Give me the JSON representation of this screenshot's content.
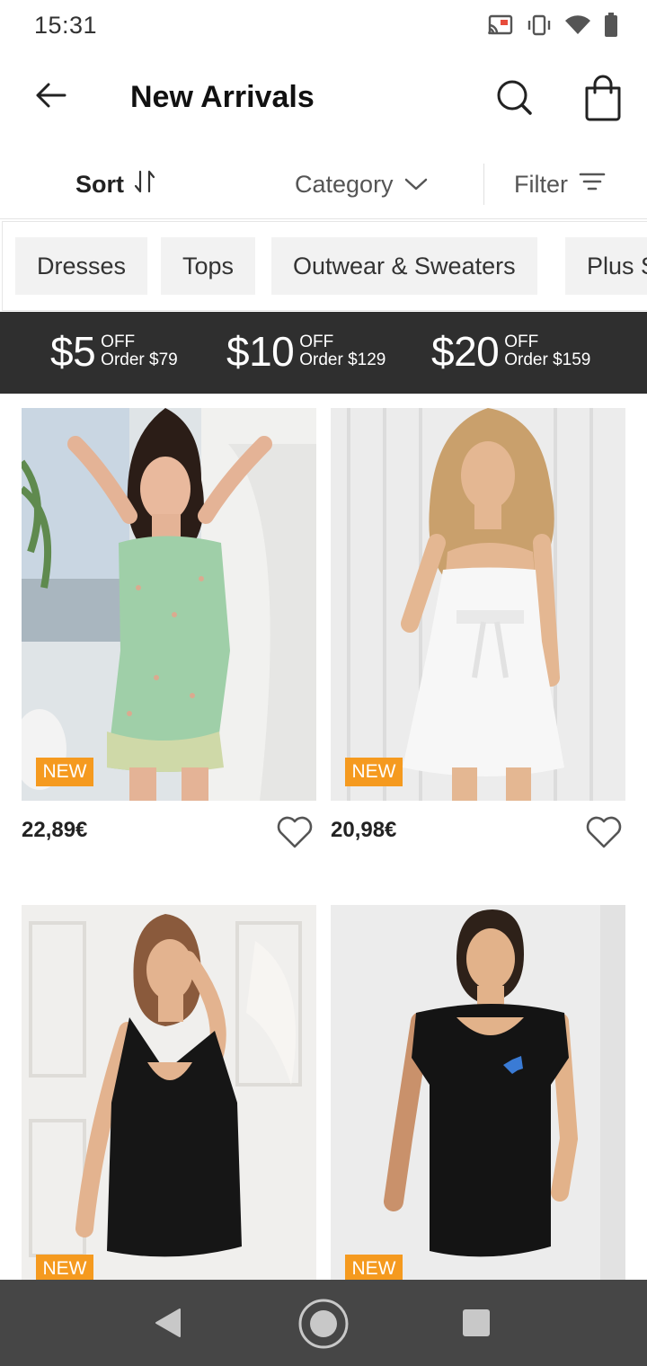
{
  "status_bar": {
    "time": "15:31",
    "icons": [
      "cast-icon",
      "vibrate-icon",
      "wifi-icon",
      "battery-icon"
    ]
  },
  "app_bar": {
    "title": "New Arrivals",
    "icons": [
      "back-arrow-icon",
      "search-icon",
      "shopping-bag-icon"
    ]
  },
  "toolbar": {
    "sort_label": "Sort",
    "category_label": "Category",
    "filter_label": "Filter"
  },
  "chips": [
    "Dresses",
    "Tops",
    "Outwear & Sweaters",
    "Plus S"
  ],
  "promos": [
    {
      "amount": "$5",
      "off": "OFF",
      "order": "Order $79"
    },
    {
      "amount": "$10",
      "off": "OFF",
      "order": "Order $129"
    },
    {
      "amount": "$20",
      "off": "OFF",
      "order": "Order $159"
    }
  ],
  "products": [
    {
      "badge": "NEW",
      "price": "22,89€",
      "image": "green floral mini dress"
    },
    {
      "badge": "NEW",
      "price": "20,98€",
      "image": "white ruffle wrap dress"
    },
    {
      "badge": "NEW",
      "price": "",
      "image": "black one-shoulder bodycon dress"
    },
    {
      "badge": "NEW",
      "price": "",
      "image": "black short-sleeve bodycon dress"
    }
  ],
  "colors": {
    "accent_badge": "#f59a1f",
    "banner_bg": "#2f2f2f",
    "nav_bar_bg": "#464646"
  }
}
